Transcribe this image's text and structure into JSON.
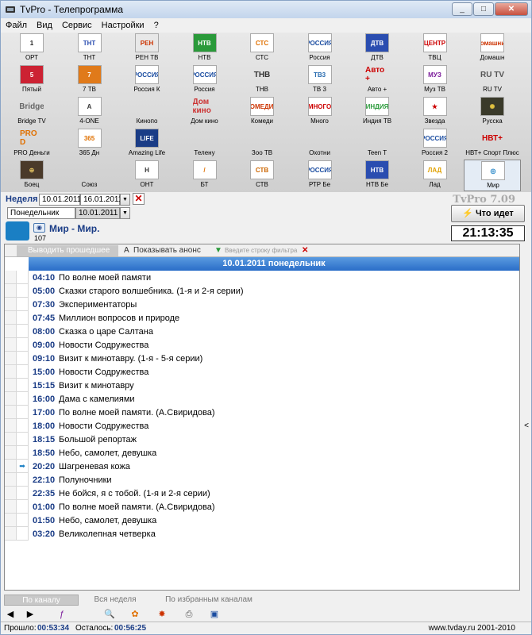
{
  "window": {
    "title": "TvPro - Телепрограмма",
    "minimize": "_",
    "maximize": "□",
    "close": "✕"
  },
  "menu": [
    "Файл",
    "Вид",
    "Сервис",
    "Настройки",
    "?"
  ],
  "channels": [
    {
      "logo": "1",
      "name": "ОРТ",
      "bg": "#ffffff",
      "fg": "#222222"
    },
    {
      "logo": "ТНТ",
      "name": "ТНТ",
      "bg": "#ffffff",
      "fg": "#2a4db0"
    },
    {
      "logo": "РЕН",
      "name": "РЕН ТВ",
      "bg": "#e8e8e8",
      "fg": "#cc3300"
    },
    {
      "logo": "НТВ",
      "name": "НТВ",
      "bg": "#2a9a3a",
      "fg": "#ffffff"
    },
    {
      "logo": "СТС",
      "name": "СТС",
      "bg": "#ffffff",
      "fg": "#e07000"
    },
    {
      "logo": "РОССИЯ",
      "name": "Россия",
      "bg": "#ffffff",
      "fg": "#1a4ca0"
    },
    {
      "logo": "ДТВ",
      "name": "ДТВ",
      "bg": "#2a4db0",
      "fg": "#ffffff"
    },
    {
      "logo": "ЦЕНТР",
      "name": "ТВЦ",
      "bg": "#ffffff",
      "fg": "#cc0000"
    },
    {
      "logo": "Домашний",
      "name": "Домашн",
      "bg": "#ffffff",
      "fg": "#cc3300"
    },
    {
      "logo": "5",
      "name": "Пятый",
      "bg": "#cc2233",
      "fg": "#ffffff"
    },
    {
      "logo": "7",
      "name": "7 ТВ",
      "bg": "#e07a1a",
      "fg": "#ffffff"
    },
    {
      "logo": "РОССИЯ",
      "name": "Россия К",
      "bg": "#ffffff",
      "fg": "#1a4ca0"
    },
    {
      "logo": "РОССИЯ",
      "name": "Россия",
      "bg": "#ffffff",
      "fg": "#1a4ca0"
    },
    {
      "logo": "ТНВ",
      "name": "ТНВ",
      "bg": "",
      "fg": "#333333"
    },
    {
      "logo": "ТВ3",
      "name": "ТВ 3",
      "bg": "#ffffff",
      "fg": "#2a6db0"
    },
    {
      "logo": "Авто +",
      "name": "Авто +",
      "bg": "",
      "fg": "#cc0000"
    },
    {
      "logo": "МУЗ",
      "name": "Муз ТВ",
      "bg": "#ffffff",
      "fg": "#7a1a9a"
    },
    {
      "logo": "RU TV",
      "name": "RU TV",
      "bg": "",
      "fg": "#555555"
    },
    {
      "logo": "Bridge",
      "name": "Bridge TV",
      "bg": "",
      "fg": "#666666"
    },
    {
      "logo": "A",
      "name": "4-ONE",
      "bg": "#ffffff",
      "fg": "#333333"
    },
    {
      "logo": "",
      "name": "Кинопо",
      "bg": "",
      "fg": "#333333"
    },
    {
      "logo": "Дом кино",
      "name": "Дом кино",
      "bg": "",
      "fg": "#cc3333"
    },
    {
      "logo": "КОМЕДИЯ",
      "name": "Комеди",
      "bg": "#ffffff",
      "fg": "#cc3300"
    },
    {
      "logo": "МНОГО",
      "name": "Много",
      "bg": "#ffffff",
      "fg": "#cc0000"
    },
    {
      "logo": "ИНДИЯ",
      "name": "Индия ТВ",
      "bg": "#ffffff",
      "fg": "#2a9a3a"
    },
    {
      "logo": "★",
      "name": "Звезда",
      "bg": "#ffffff",
      "fg": "#cc0000"
    },
    {
      "logo": "✺",
      "name": "Русска",
      "bg": "#3a3a2a",
      "fg": "#e0c040"
    },
    {
      "logo": "PRO D",
      "name": "PRO Деньги",
      "bg": "",
      "fg": "#e07000"
    },
    {
      "logo": "365",
      "name": "365 Дн",
      "bg": "#ffffff",
      "fg": "#e07000"
    },
    {
      "logo": "LIFE",
      "name": "Amazing Life",
      "bg": "#1a3c86",
      "fg": "#ffffff"
    },
    {
      "logo": "",
      "name": "Телену",
      "bg": "",
      "fg": "#333333"
    },
    {
      "logo": "",
      "name": "Зоо ТВ",
      "bg": "",
      "fg": "#333333"
    },
    {
      "logo": "",
      "name": "Охотни",
      "bg": "",
      "fg": "#333333"
    },
    {
      "logo": "",
      "name": "Teen T",
      "bg": "",
      "fg": "#333333"
    },
    {
      "logo": "РОССИЯ",
      "name": "Россия 2",
      "bg": "#ffffff",
      "fg": "#1a4ca0"
    },
    {
      "logo": "НВТ+",
      "name": "НВТ+ Спорт Плюс",
      "bg": "",
      "fg": "#cc0000"
    },
    {
      "logo": "⊕",
      "name": "Боец",
      "bg": "#4a3a2a",
      "fg": "#e0c060"
    },
    {
      "logo": "",
      "name": "Союз",
      "bg": "",
      "fg": "#333333"
    },
    {
      "logo": "Н",
      "name": "ОНТ",
      "bg": "#ffffff",
      "fg": "#333333"
    },
    {
      "logo": "/",
      "name": "БТ",
      "bg": "#ffffff",
      "fg": "#e07000"
    },
    {
      "logo": "СТВ",
      "name": "СТВ",
      "bg": "#ffffff",
      "fg": "#cc6600"
    },
    {
      "logo": "РОССИЯ",
      "name": "РТР Бе",
      "bg": "#ffffff",
      "fg": "#1a4ca0"
    },
    {
      "logo": "НТВ",
      "name": "НТВ Бе",
      "bg": "#2a4db0",
      "fg": "#ffffff"
    },
    {
      "logo": "ЛАД",
      "name": "Лад",
      "bg": "#ffffff",
      "fg": "#e0a000"
    },
    {
      "logo": "◎",
      "name": "Мир",
      "bg": "#ffffff",
      "fg": "#1a7fc4"
    }
  ],
  "controls": {
    "week_label": "Неделя",
    "date_from": "10.01.2011",
    "date_to": "16.01.2011",
    "day_name": "Понедельник",
    "day_date": "10.01.2011",
    "channel_title": "Мир - Мир.",
    "channel_number": "107",
    "logo_main": "TvPro",
    "logo_version": "7.09",
    "whats_on": "Что идет",
    "clock": "21:13:35"
  },
  "grid_toolbar": {
    "show_past": "Выводить прошедшее",
    "show_announce": "Показывать анонс",
    "filter_placeholder": "Введите строку фильтра"
  },
  "day_header": "10.01.2011 понедельник",
  "programs": [
    {
      "time": "04:10",
      "name": "По волне моей памяти",
      "marker": ""
    },
    {
      "time": "05:00",
      "name": "Сказки старого волшебника. (1-я и 2-я серии)",
      "marker": ""
    },
    {
      "time": "07:30",
      "name": "Экспериментаторы",
      "marker": ""
    },
    {
      "time": "07:45",
      "name": "Миллион вопросов и природе",
      "marker": ""
    },
    {
      "time": "08:00",
      "name": "Сказка о царе Салтана",
      "marker": ""
    },
    {
      "time": "09:00",
      "name": "Новости Содружества",
      "marker": ""
    },
    {
      "time": "09:10",
      "name": "Визит к минотавру. (1-я - 5-я серии)",
      "marker": ""
    },
    {
      "time": "15:00",
      "name": "Новости Содружества",
      "marker": ""
    },
    {
      "time": "15:15",
      "name": "Визит к минотавру",
      "marker": ""
    },
    {
      "time": "16:00",
      "name": "Дама с камелиями",
      "marker": ""
    },
    {
      "time": "17:00",
      "name": "По волне моей памяти. (А.Свиридова)",
      "marker": ""
    },
    {
      "time": "18:00",
      "name": "Новости Содружества",
      "marker": ""
    },
    {
      "time": "18:15",
      "name": "Большой репортаж",
      "marker": ""
    },
    {
      "time": "18:50",
      "name": "Небо, самолет, девушка",
      "marker": ""
    },
    {
      "time": "20:20",
      "name": "Шагреневая кожа",
      "marker": "➡"
    },
    {
      "time": "22:10",
      "name": "Полуночники",
      "marker": ""
    },
    {
      "time": "22:35",
      "name": "Не бойся, я с тобой. (1-я и 2-я серии)",
      "marker": ""
    },
    {
      "time": "01:00",
      "name": "По волне моей памяти. (А.Свиридова)",
      "marker": ""
    },
    {
      "time": "01:50",
      "name": "Небо, самолет, девушка",
      "marker": ""
    },
    {
      "time": "03:20",
      "name": "Великолепная четверка",
      "marker": ""
    }
  ],
  "tabs": [
    "По каналу",
    "Вся неделя",
    "По избранным каналам"
  ],
  "status": {
    "elapsed_label": "Прошло:",
    "elapsed": "00:53:34",
    "remaining_label": "Осталось:",
    "remaining": "00:56:25",
    "copyright": "www.tvday.ru 2001-2010"
  }
}
